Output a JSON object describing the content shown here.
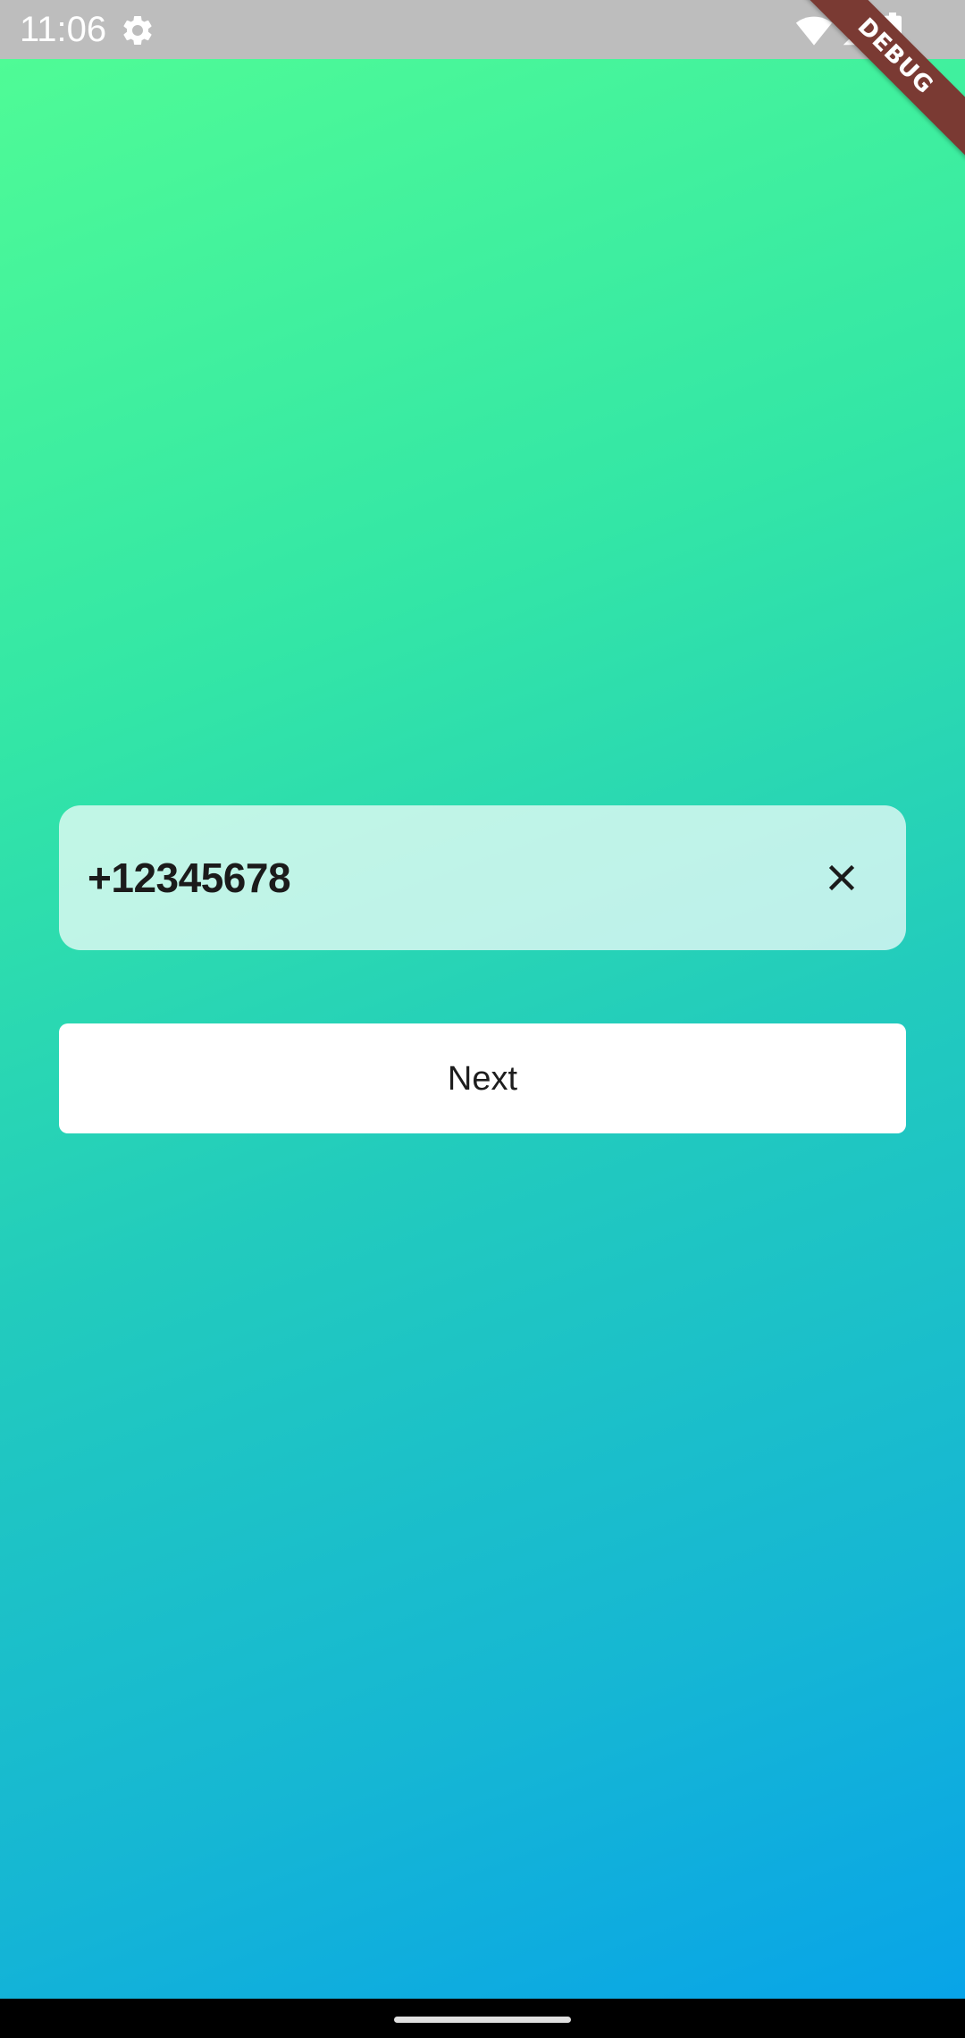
{
  "status_bar": {
    "time": "11:06",
    "icons": [
      "gear-icon",
      "wifi-icon",
      "signal-icon",
      "battery-icon"
    ]
  },
  "debug_banner": {
    "label": "DEBUG",
    "color": "#7a3a33"
  },
  "background": {
    "gradient_top_left": "#4ffb96",
    "gradient_bottom_right": "#08a4e8"
  },
  "phone_input": {
    "value": "+12345678",
    "clear_icon": "close-icon"
  },
  "next_button": {
    "label": "Next"
  }
}
